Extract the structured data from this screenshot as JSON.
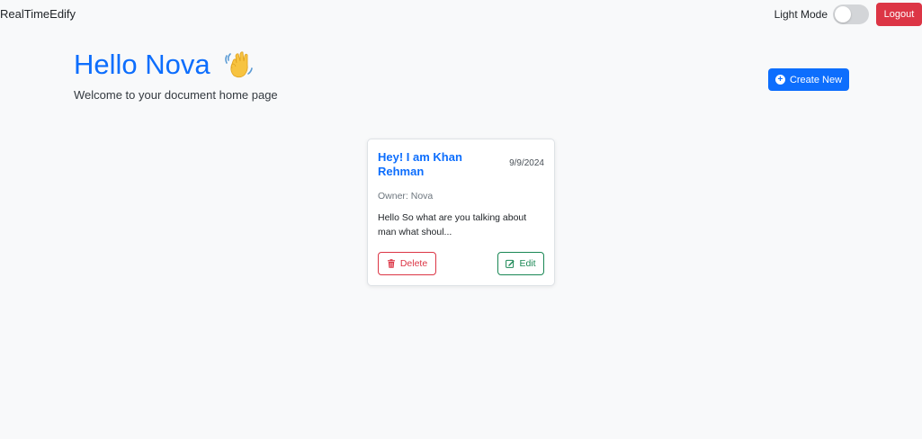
{
  "navbar": {
    "brand": "RealTimeEdify",
    "mode_label": "Light Mode",
    "mode_toggle_on": false,
    "logout_label": "Logout"
  },
  "greeting": {
    "title": "Hello Nova",
    "subtitle": "Welcome to your document home page",
    "emoji_icon": "waving-hand-icon"
  },
  "actions": {
    "create_label": "Create New",
    "create_icon": "plus-circle-icon"
  },
  "documents": [
    {
      "title": "Hey! I am Khan Rehman",
      "date": "9/9/2024",
      "owner": "Owner: Nova",
      "preview": "Hello So what are you talking about man what shoul...",
      "delete_label": "Delete",
      "delete_icon": "trash-icon",
      "edit_label": "Edit",
      "edit_icon": "edit-icon"
    }
  ],
  "colors": {
    "background": "#f8f9fa",
    "primary": "#0d6efd",
    "danger": "#dc3545",
    "success": "#198754"
  }
}
